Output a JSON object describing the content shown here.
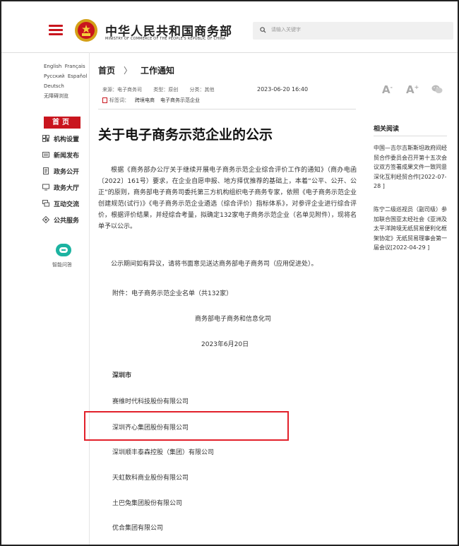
{
  "header": {
    "site_title": "中华人民共和国商务部",
    "site_subtitle": "MINISTRY OF COMMERCE OF THE PEOPLE'S REPUBLIC OF CHINA",
    "search_placeholder": "请输入关键字"
  },
  "languages": [
    "English",
    "Français",
    "Русский",
    "Español",
    "Deutsch",
    "无障碍浏览"
  ],
  "nav": {
    "home": "首页",
    "items": [
      "机构设置",
      "新闻发布",
      "政务公开",
      "政务大厅",
      "互动交流",
      "公共服务"
    ],
    "assistant": "智能问答"
  },
  "breadcrumb": {
    "home": "首页",
    "sep": "〉",
    "current": "工作通知"
  },
  "meta": {
    "source": "来源：电子商务司",
    "type": "类型：原创",
    "category": "分类：其他",
    "date": "2023-06-20 16:40",
    "tags_label": "标签词：",
    "tags": [
      "跨境电商",
      "电子商务示范企业"
    ]
  },
  "article": {
    "title": "关于电子商务示范企业的公示",
    "para1": "根据《商务部办公厅关于继续开展电子商务示范企业综合评价工作的通知》（商办电函〔2022〕161号）要求，在企业自愿申报、地方择优推荐的基础上，本着“公平、公开、公正”的原则，商务部电子商务司委托第三方机构组织电子商务专家，依照《电子商务示范企业创建规范(试行)》《电子商务示范企业遴选（综合评价）指标体系》，对参评企业进行综合评价，根据评价结果，并经综合考量，拟确定132家电子商务示范企业（名单见附件），现将名单予以公示。",
    "para2": "公示期间如有异议，请将书面意见送达商务部电子商务司（应用促进处）。",
    "attachment": "附件：电子商务示范企业名单（共132家）",
    "signature": "商务部电子商务和信息化司",
    "sign_date": "2023年6月20日",
    "section": "深圳市",
    "companies": [
      "赛维时代科技股份有限公司",
      "深圳齐心集团股份有限公司",
      "深圳顺丰泰森控股（集团）有限公司",
      "天虹数科商业股份有限公司",
      "土巴兔集团股份有限公司",
      "优合集团有限公司"
    ]
  },
  "related": {
    "title": "相关阅读",
    "items": [
      "中国—吉尔吉斯斯坦政府间经贸合作委员会召开第十五次会议双方签署成果文件一致同意深化互利经贸合作[2022-07-28 ]",
      "陈宁二级巡视员（副司级）参加联合国亚太经社会《亚洲及太平洋跨境无纸贸易便利化框架协定》无纸贸易理事会第一届会议[2022-04-29 ]"
    ]
  },
  "font_controls": [
    "A-",
    "A+"
  ],
  "colors": {
    "brand_red": "#c9151e",
    "assistant": "#1cb3a1",
    "highlight": "#e2202a"
  }
}
